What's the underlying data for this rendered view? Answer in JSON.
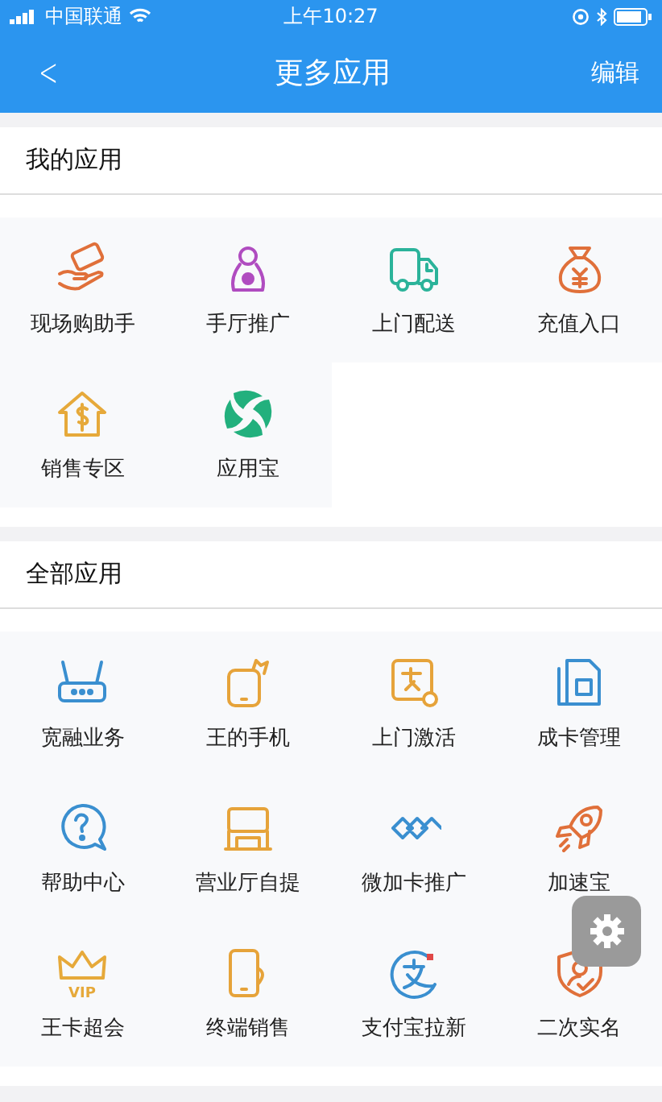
{
  "status_bar": {
    "carrier": "中国联通",
    "time": "上午10:27"
  },
  "nav": {
    "back": "<",
    "title": "更多应用",
    "action": "编辑"
  },
  "sections": [
    {
      "title": "我的应用",
      "apps": [
        {
          "label": "现场购助手",
          "kind": "hand-card",
          "color": "#e0703a"
        },
        {
          "label": "手厅推广",
          "kind": "person",
          "color": "#b04cc0"
        },
        {
          "label": "上门配送",
          "kind": "truck",
          "color": "#2bb39a"
        },
        {
          "label": "充值入口",
          "kind": "money-bag",
          "color": "#e0703a"
        },
        {
          "label": "销售专区",
          "kind": "house-dollar",
          "color": "#e6a93a"
        },
        {
          "label": "应用宝",
          "kind": "leaf-ring",
          "color": "#22b07d"
        }
      ]
    },
    {
      "title": "全部应用",
      "apps": [
        {
          "label": "宽融业务",
          "kind": "router",
          "color": "#3a8fd0"
        },
        {
          "label": "王的手机",
          "kind": "phone-crown",
          "color": "#e6a33a"
        },
        {
          "label": "上门激活",
          "kind": "sign-key",
          "color": "#e6a33a"
        },
        {
          "label": "成卡管理",
          "kind": "sim",
          "color": "#3a8fd0"
        },
        {
          "label": "帮助中心",
          "kind": "question",
          "color": "#3a8fd0"
        },
        {
          "label": "营业厅自提",
          "kind": "store",
          "color": "#e6a33a"
        },
        {
          "label": "微加卡推广",
          "kind": "diamonds",
          "color": "#3a8fd0"
        },
        {
          "label": "加速宝",
          "kind": "rocket",
          "color": "#e0703a"
        },
        {
          "label": "王卡超会",
          "kind": "crown",
          "color": "#e6a93a",
          "icon_text": "VIP"
        },
        {
          "label": "终端销售",
          "kind": "phone",
          "color": "#e6a33a"
        },
        {
          "label": "支付宝拉新",
          "kind": "pay",
          "color": "#3a8fd0"
        },
        {
          "label": "二次实名",
          "kind": "shield",
          "color": "#e0703a"
        }
      ]
    }
  ]
}
